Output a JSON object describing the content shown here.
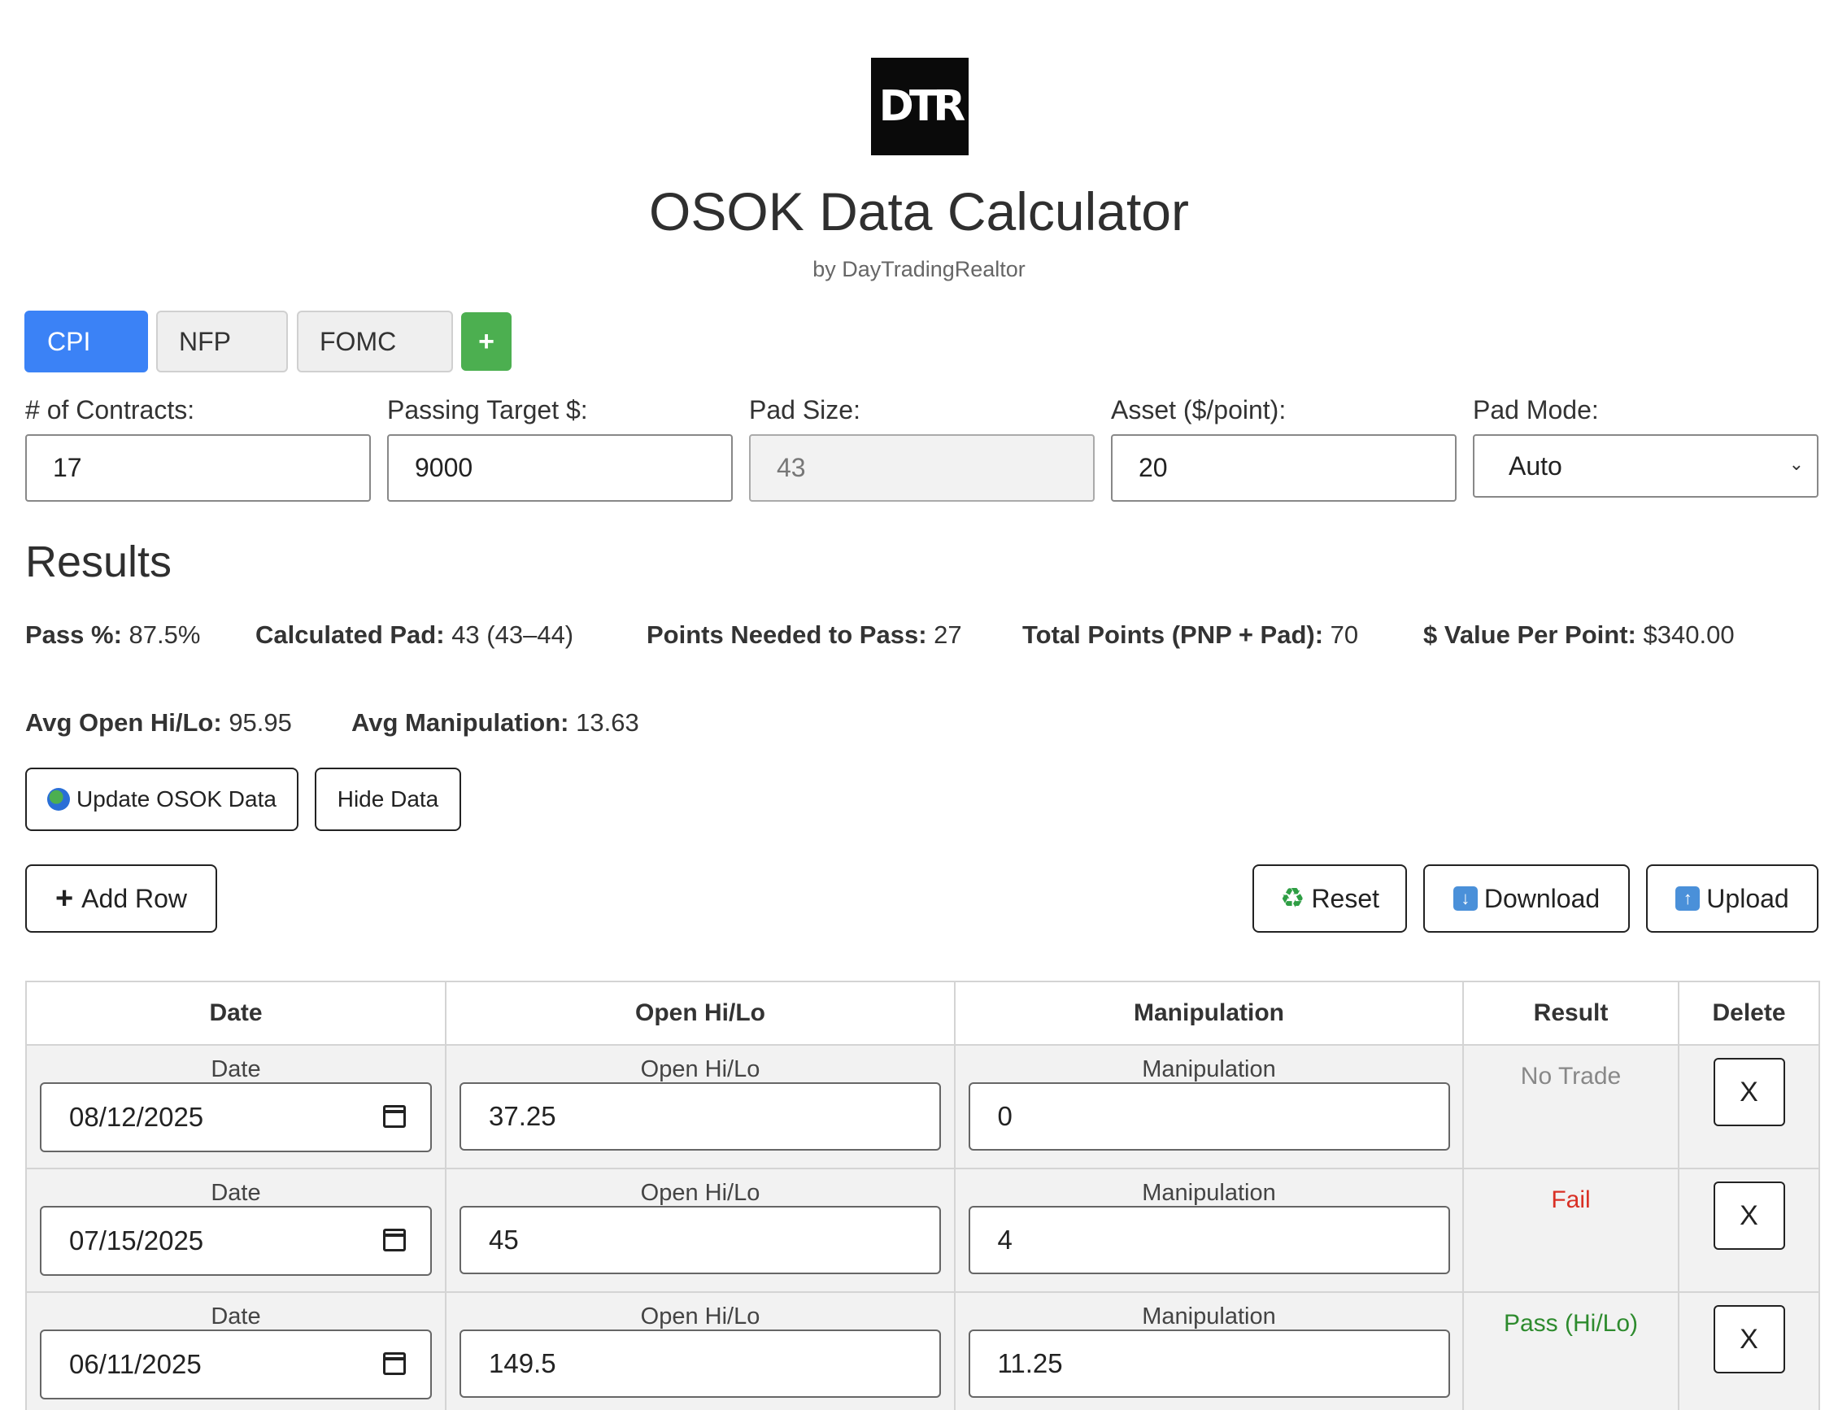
{
  "header": {
    "logo_text": "DTR",
    "title": "OSOK Data Calculator",
    "subtitle": "by DayTradingRealtor"
  },
  "tabs": [
    {
      "label": "CPI",
      "active": true
    },
    {
      "label": "NFP",
      "active": false
    },
    {
      "label": "FOMC",
      "active": false
    }
  ],
  "add_tab_label": "+",
  "fields": {
    "contracts": {
      "label": "# of Contracts:",
      "value": "17"
    },
    "passing_target": {
      "label": "Passing Target $:",
      "value": "9000"
    },
    "pad_size": {
      "label": "Pad Size:",
      "value": "43"
    },
    "asset": {
      "label": "Asset ($/point):",
      "value": "20"
    },
    "pad_mode": {
      "label": "Pad Mode:",
      "value": "Auto"
    }
  },
  "results": {
    "heading": "Results",
    "pass_pct": {
      "label": "Pass %:",
      "value": "87.5%"
    },
    "calculated_pad": {
      "label": "Calculated Pad:",
      "value": "43 (43–44)"
    },
    "points_needed": {
      "label": "Points Needed to Pass:",
      "value": "27"
    },
    "total_points": {
      "label": "Total Points (PNP + Pad):",
      "value": "70"
    },
    "value_per_point": {
      "label": "$ Value Per Point:",
      "value": "$340.00"
    },
    "avg_open": {
      "label": "Avg Open Hi/Lo:",
      "value": "95.95"
    },
    "avg_manip": {
      "label": "Avg Manipulation:",
      "value": "13.63"
    }
  },
  "buttons": {
    "update": "Update OSOK Data",
    "hide": "Hide Data",
    "add_row": "Add Row",
    "reset": "Reset",
    "download": "Download",
    "upload": "Upload"
  },
  "table": {
    "headers": [
      "Date",
      "Open Hi/Lo",
      "Manipulation",
      "Result",
      "Delete"
    ],
    "cell_labels": {
      "date": "Date",
      "open": "Open Hi/Lo",
      "manip": "Manipulation"
    },
    "delete_label": "X",
    "rows": [
      {
        "date": "08/12/2025",
        "open": "37.25",
        "manip": "0",
        "result": "No Trade",
        "result_color": "#888888"
      },
      {
        "date": "07/15/2025",
        "open": "45",
        "manip": "4",
        "result": "Fail",
        "result_color": "#d93025"
      },
      {
        "date": "06/11/2025",
        "open": "149.5",
        "manip": "11.25",
        "result": "Pass (Hi/Lo)",
        "result_color": "#2e8b2e"
      }
    ]
  }
}
